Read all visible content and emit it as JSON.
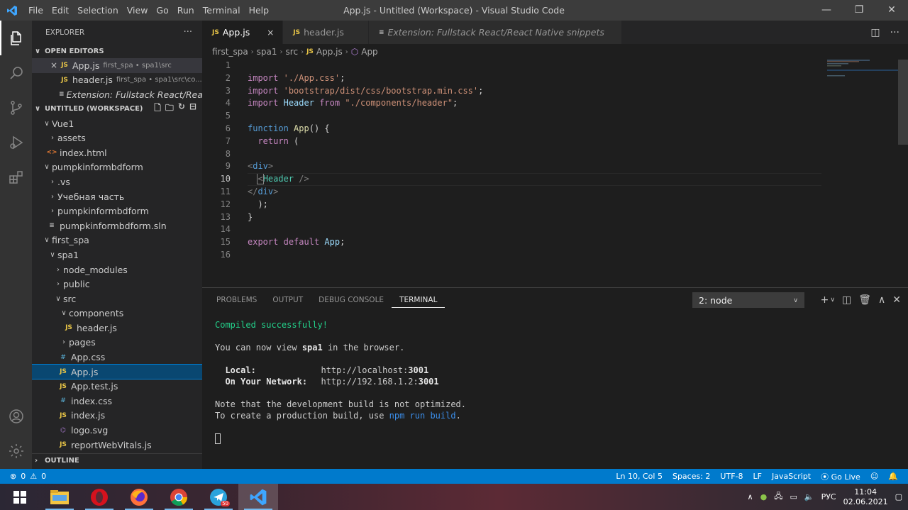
{
  "window": {
    "title": "App.js - Untitled (Workspace) - Visual Studio Code",
    "menu": [
      "File",
      "Edit",
      "Selection",
      "View",
      "Go",
      "Run",
      "Terminal",
      "Help"
    ]
  },
  "sidebar": {
    "title": "EXPLORER",
    "more": "···",
    "open_editors_label": "OPEN EDITORS",
    "open_editors": [
      {
        "icon": "JS",
        "name": "App.js",
        "desc": "first_spa • spa1\\src"
      },
      {
        "icon": "JS",
        "name": "header.js",
        "desc": "first_spa • spa1\\src\\co..."
      },
      {
        "icon": "≡",
        "name": "Extension: Fullstack React/React ..."
      }
    ],
    "workspace_label": "UNTITLED (WORKSPACE)",
    "tree": [
      {
        "name": "Vue1"
      },
      {
        "name": "assets"
      },
      {
        "icon": "<>",
        "name": "index.html"
      },
      {
        "name": "pumpkinformbdform"
      },
      {
        "name": ".vs"
      },
      {
        "name": "Учебная часть"
      },
      {
        "name": "pumpkinformbdform"
      },
      {
        "icon": "≡",
        "name": "pumpkinformbdform.sln"
      },
      {
        "name": "first_spa"
      },
      {
        "name": "spa1"
      },
      {
        "name": "node_modules"
      },
      {
        "name": "public"
      },
      {
        "name": "src"
      },
      {
        "name": "components"
      },
      {
        "icon": "JS",
        "name": "header.js"
      },
      {
        "name": "pages"
      },
      {
        "icon": "#",
        "name": "App.css"
      },
      {
        "icon": "JS",
        "name": "App.js"
      },
      {
        "icon": "JS",
        "name": "App.test.js"
      },
      {
        "icon": "#",
        "name": "index.css"
      },
      {
        "icon": "JS",
        "name": "index.js"
      },
      {
        "icon": "⌬",
        "name": "logo.svg"
      },
      {
        "icon": "JS",
        "name": "reportWebVitals.js"
      }
    ],
    "outline_label": "OUTLINE"
  },
  "tabs": [
    {
      "icon": "JS",
      "label": "App.js",
      "close": "×"
    },
    {
      "icon": "JS",
      "label": "header.js"
    },
    {
      "icon": "≡",
      "label": "Extension: Fullstack React/React Native snippets"
    }
  ],
  "breadcrumb": [
    "first_spa",
    "spa1",
    "src",
    "JS",
    "App.js",
    "App"
  ],
  "code": {
    "line_numbers": [
      "1",
      "2",
      "3",
      "4",
      "5",
      "6",
      "7",
      "8",
      "9",
      "10",
      "11",
      "12",
      "13",
      "14",
      "15",
      "16"
    ],
    "l2": {
      "kw": "import",
      "str": "'./App.css'",
      "end": ";"
    },
    "l3": {
      "kw": "import",
      "str": "'bootstrap/dist/css/bootstrap.min.css'",
      "end": ";"
    },
    "l4": {
      "kw": "import",
      "id": "Header",
      "from": "from",
      "str": "\"./components/header\"",
      "end": ";"
    },
    "l6": {
      "kw": "function",
      "fn": "App",
      "rest": "() {"
    },
    "l7": {
      "kw": "return",
      "rest": " ("
    },
    "l9": {
      "open": "<",
      "tag": "div",
      "close": ">"
    },
    "l10": {
      "open": "<",
      "comp": "Header",
      "close": " />"
    },
    "l11": {
      "open": "</",
      "tag": "div",
      "close": ">"
    },
    "l12": {
      "rest": ");"
    },
    "l13": {
      "rest": "}"
    },
    "l15": {
      "kw": "export",
      "kw2": "default",
      "id": "App",
      "end": ";"
    }
  },
  "panel": {
    "tabs": [
      "PROBLEMS",
      "OUTPUT",
      "DEBUG CONSOLE",
      "TERMINAL"
    ],
    "terminal_select": "2: node",
    "terminal": {
      "compiled": "Compiled successfully!",
      "view_pre": "You can now view ",
      "view_app": "spa1",
      "view_post": " in the browser.",
      "local_label": "Local:",
      "local_url": "http://localhost:",
      "local_port": "3001",
      "network_label": "On Your Network:",
      "network_url": "http://192.168.1.2:",
      "network_port": "3001",
      "note1": "Note that the development build is not optimized.",
      "note2_pre": "To create a production build, use ",
      "note2_cmd": "npm run build",
      "note2_post": "."
    }
  },
  "statusbar": {
    "errors": "0",
    "warnings": "0",
    "position": "Ln 10, Col 5",
    "spaces": "Spaces: 2",
    "encoding": "UTF-8",
    "eol": "LF",
    "language": "JavaScript",
    "golive": "Go Live"
  },
  "taskbar": {
    "badge": "50",
    "lang": "РУС",
    "time": "11:04",
    "date": "02.06.2021"
  }
}
